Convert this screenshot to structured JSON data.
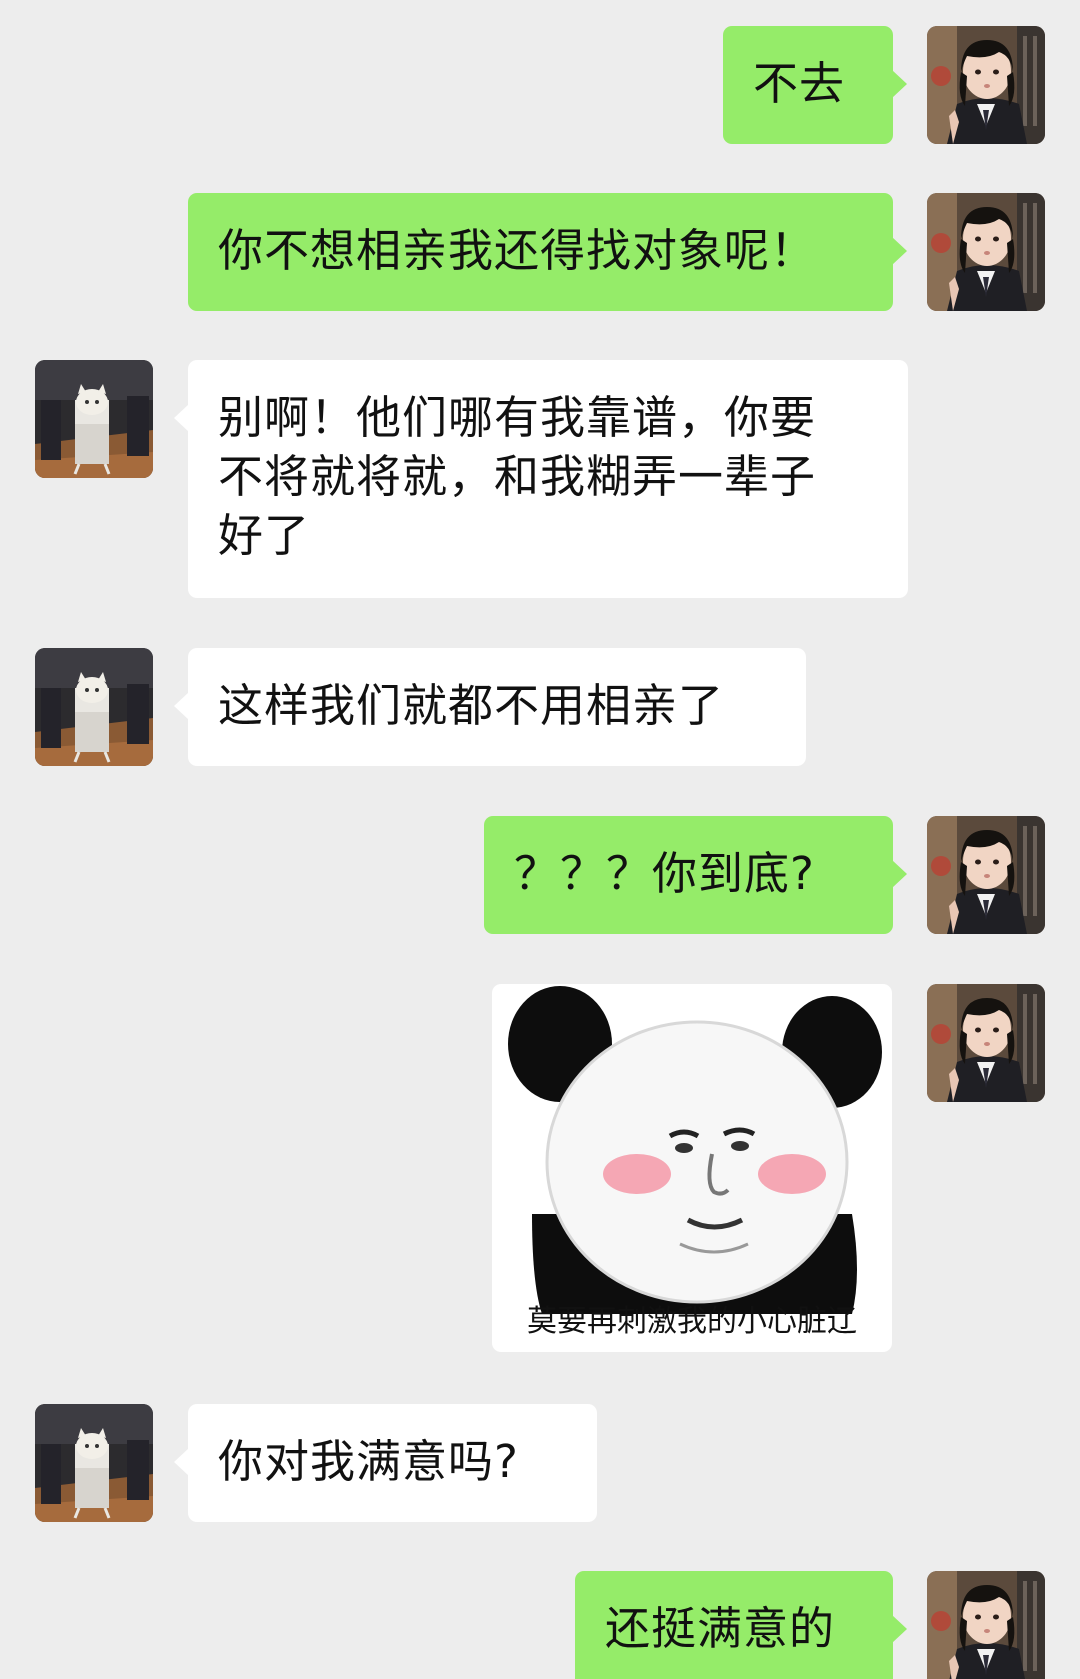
{
  "conversation": {
    "messages": [
      {
        "sender": "me",
        "text": "不去"
      },
      {
        "sender": "me",
        "text": "你不想相亲我还得找对象呢！"
      },
      {
        "sender": "them",
        "text": "别啊！他们哪有我靠谱，你要\n不将就将就，和我糊弄一辈子\n好了"
      },
      {
        "sender": "them",
        "text": "这样我们就都不用相亲了"
      },
      {
        "sender": "me",
        "text": "？？？你到底?"
      },
      {
        "sender": "me",
        "type": "sticker",
        "sticker_icon": "panda-meme-sticker",
        "caption": "莫要再刺激我的小心脏辽"
      },
      {
        "sender": "them",
        "text": "你对我满意吗?"
      },
      {
        "sender": "me",
        "text": "还挺满意的"
      }
    ]
  },
  "avatars": {
    "me": "girl-photo-avatar",
    "them": "cat-photo-avatar"
  },
  "colors": {
    "background": "#ededed",
    "my_bubble": "#95ec69",
    "their_bubble": "#ffffff"
  }
}
